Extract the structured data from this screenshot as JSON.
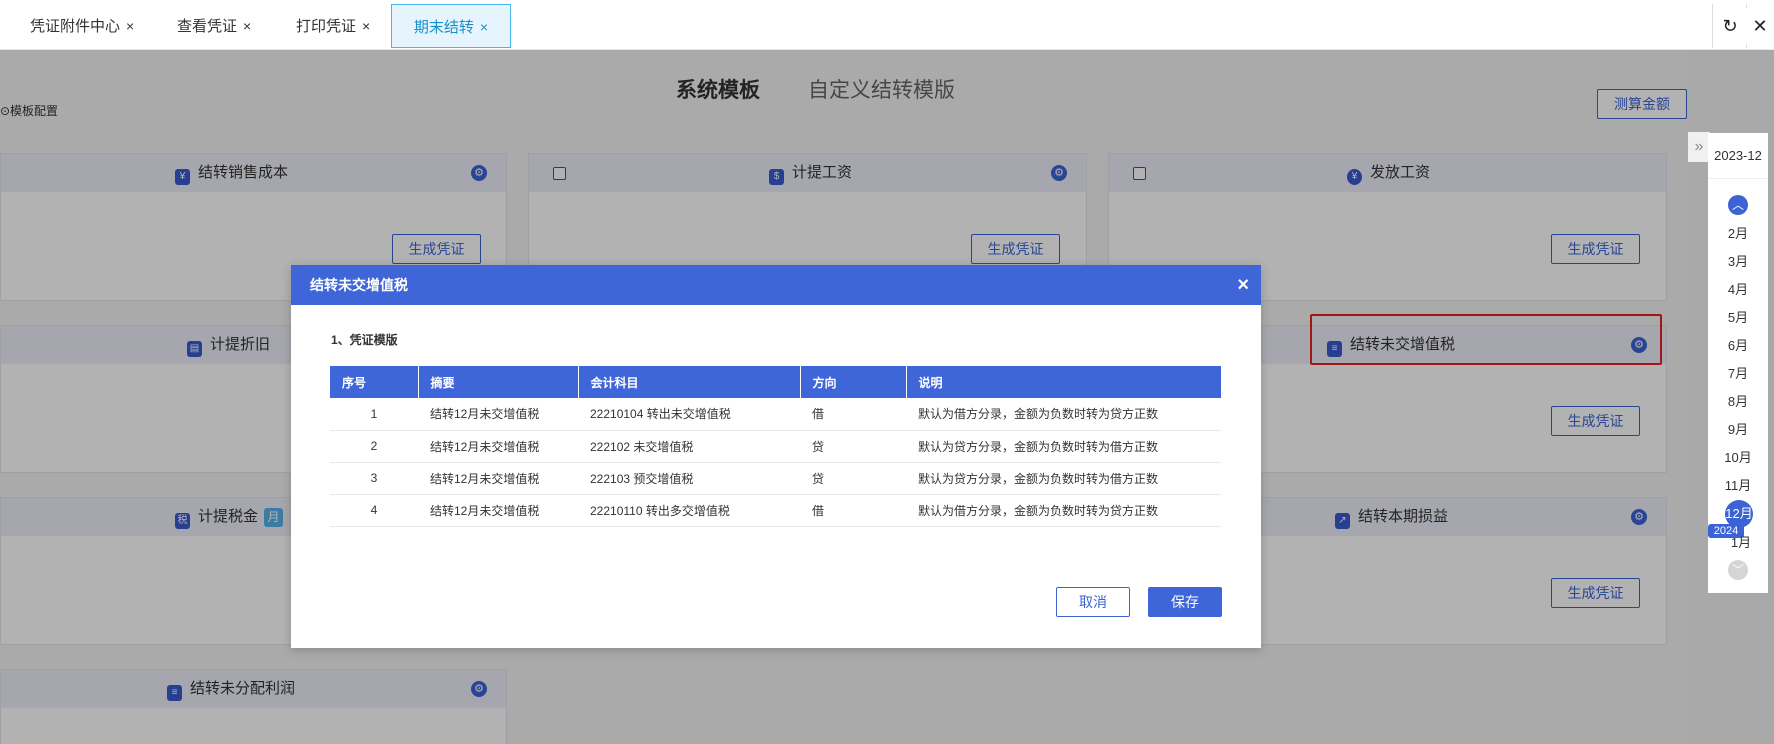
{
  "tabs": [
    {
      "label": "凭证附件中心",
      "close": "×"
    },
    {
      "label": "查看凭证",
      "close": "×"
    },
    {
      "label": "打印凭证",
      "close": "×"
    },
    {
      "label": "期末结转",
      "close": "×"
    }
  ],
  "toolbar": {
    "refresh": "↻",
    "close": "✕"
  },
  "segments": {
    "system": "系统模板",
    "custom": "自定义结转模版"
  },
  "template_config": "⊙模板配置",
  "calc_button": "测算金额",
  "cards": [
    {
      "title": "结转销售成本",
      "button": "生成凭证"
    },
    {
      "title": "计提工资",
      "button": "生成凭证"
    },
    {
      "title": "发放工资",
      "button": "生成凭证"
    },
    {
      "title": "计提折旧"
    },
    {
      "title": "结转未交增值税",
      "button": "生成凭证"
    },
    {
      "title": "计提税金",
      "badge": "月"
    },
    {
      "title": "结转本期损益",
      "button": "生成凭证"
    },
    {
      "title": "结转未分配利润"
    }
  ],
  "rail": {
    "year_month": "2023-12",
    "months": [
      "2月",
      "3月",
      "4月",
      "5月",
      "6月",
      "7月",
      "8月",
      "9月",
      "10月",
      "11月"
    ],
    "selected": "12月",
    "year_tag": "2024",
    "next": "1月",
    "collapse": "»"
  },
  "modal": {
    "title": "结转未交增值税",
    "close": "×",
    "section": "1、凭证模版",
    "columns": [
      "序号",
      "摘要",
      "会计科目",
      "方向",
      "说明"
    ],
    "rows": [
      {
        "no": "1",
        "summary": "结转12月未交增值税",
        "account": "22210104 转出未交增值税",
        "direction": "借",
        "note": "默认为借方分录，金额为负数时转为贷方正数"
      },
      {
        "no": "2",
        "summary": "结转12月未交增值税",
        "account": "222102 未交增值税",
        "direction": "贷",
        "note": "默认为贷方分录，金额为负数时转为借方正数"
      },
      {
        "no": "3",
        "summary": "结转12月未交增值税",
        "account": "222103 预交增值税",
        "direction": "贷",
        "note": "默认为贷方分录，金额为负数时转为借方正数"
      },
      {
        "no": "4",
        "summary": "结转12月未交增值税",
        "account": "22210110 转出多交增值税",
        "direction": "借",
        "note": "默认为借方分录，金额为负数时转为贷方正数"
      }
    ],
    "cancel": "取消",
    "save": "保存"
  }
}
